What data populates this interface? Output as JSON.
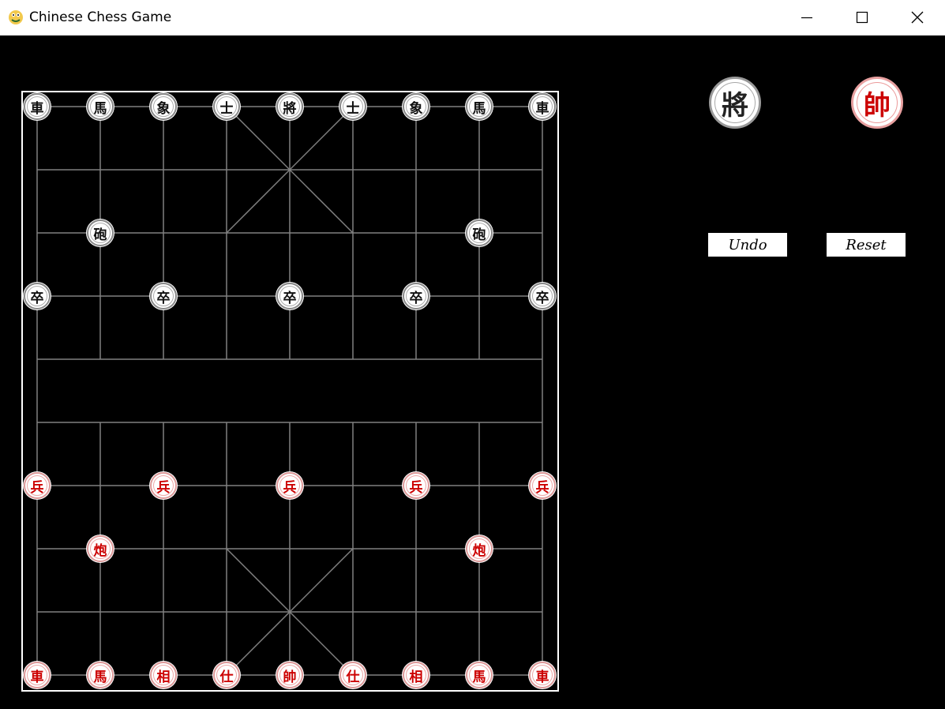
{
  "window": {
    "title": "Chinese Chess Game"
  },
  "board": {
    "columns": 9,
    "rows": 10,
    "line_color": "#808080",
    "frame_color": "#ffffff",
    "pieces": [
      {
        "side": "black",
        "char": "車",
        "file": 0,
        "rank": 0
      },
      {
        "side": "black",
        "char": "馬",
        "file": 1,
        "rank": 0
      },
      {
        "side": "black",
        "char": "象",
        "file": 2,
        "rank": 0
      },
      {
        "side": "black",
        "char": "士",
        "file": 3,
        "rank": 0
      },
      {
        "side": "black",
        "char": "將",
        "file": 4,
        "rank": 0
      },
      {
        "side": "black",
        "char": "士",
        "file": 5,
        "rank": 0
      },
      {
        "side": "black",
        "char": "象",
        "file": 6,
        "rank": 0
      },
      {
        "side": "black",
        "char": "馬",
        "file": 7,
        "rank": 0
      },
      {
        "side": "black",
        "char": "車",
        "file": 8,
        "rank": 0
      },
      {
        "side": "black",
        "char": "砲",
        "file": 1,
        "rank": 2
      },
      {
        "side": "black",
        "char": "砲",
        "file": 7,
        "rank": 2
      },
      {
        "side": "black",
        "char": "卒",
        "file": 0,
        "rank": 3
      },
      {
        "side": "black",
        "char": "卒",
        "file": 2,
        "rank": 3
      },
      {
        "side": "black",
        "char": "卒",
        "file": 4,
        "rank": 3
      },
      {
        "side": "black",
        "char": "卒",
        "file": 6,
        "rank": 3
      },
      {
        "side": "black",
        "char": "卒",
        "file": 8,
        "rank": 3
      },
      {
        "side": "red",
        "char": "兵",
        "file": 0,
        "rank": 6
      },
      {
        "side": "red",
        "char": "兵",
        "file": 2,
        "rank": 6
      },
      {
        "side": "red",
        "char": "兵",
        "file": 4,
        "rank": 6
      },
      {
        "side": "red",
        "char": "兵",
        "file": 6,
        "rank": 6
      },
      {
        "side": "red",
        "char": "兵",
        "file": 8,
        "rank": 6
      },
      {
        "side": "red",
        "char": "炮",
        "file": 1,
        "rank": 7
      },
      {
        "side": "red",
        "char": "炮",
        "file": 7,
        "rank": 7
      },
      {
        "side": "red",
        "char": "車",
        "file": 0,
        "rank": 9
      },
      {
        "side": "red",
        "char": "馬",
        "file": 1,
        "rank": 9
      },
      {
        "side": "red",
        "char": "相",
        "file": 2,
        "rank": 9
      },
      {
        "side": "red",
        "char": "仕",
        "file": 3,
        "rank": 9
      },
      {
        "side": "red",
        "char": "帥",
        "file": 4,
        "rank": 9
      },
      {
        "side": "red",
        "char": "仕",
        "file": 5,
        "rank": 9
      },
      {
        "side": "red",
        "char": "相",
        "file": 6,
        "rank": 9
      },
      {
        "side": "red",
        "char": "馬",
        "file": 7,
        "rank": 9
      },
      {
        "side": "red",
        "char": "車",
        "file": 8,
        "rank": 9
      }
    ]
  },
  "side_panel": {
    "black_general": "將",
    "red_general": "帥",
    "undo_label": "Undo",
    "reset_label": "Reset"
  },
  "colors": {
    "background": "#000000",
    "red_piece_text": "#cc0000",
    "black_piece_text": "#111111"
  }
}
